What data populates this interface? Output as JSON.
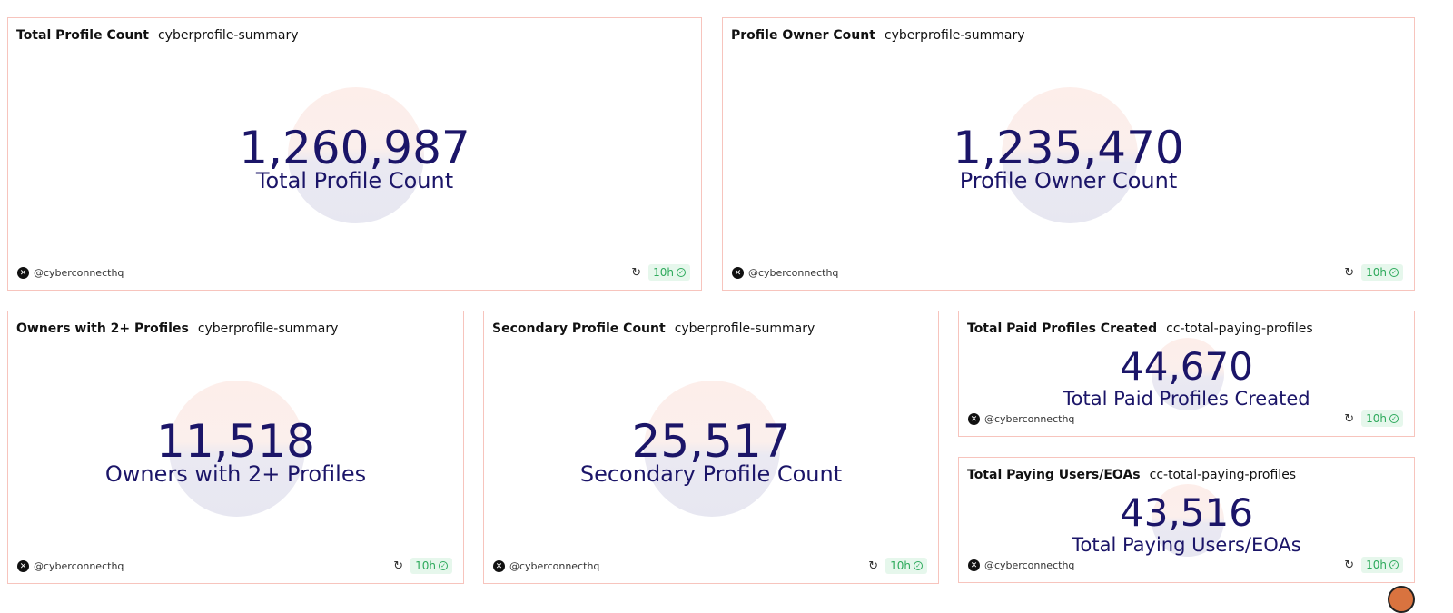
{
  "cards": [
    {
      "title": "Total Profile Count",
      "query": "cyberprofile-summary",
      "value": "1,260,987",
      "label": "Total Profile Count",
      "author": "@cyberconnecthq",
      "age": "10h"
    },
    {
      "title": "Profile Owner Count",
      "query": "cyberprofile-summary",
      "value": "1,235,470",
      "label": "Profile Owner Count",
      "author": "@cyberconnecthq",
      "age": "10h"
    },
    {
      "title": "Owners with 2+ Profiles",
      "query": "cyberprofile-summary",
      "value": "11,518",
      "label": "Owners with 2+ Profiles",
      "author": "@cyberconnecthq",
      "age": "10h"
    },
    {
      "title": "Secondary Profile Count",
      "query": "cyberprofile-summary",
      "value": "25,517",
      "label": "Secondary Profile Count",
      "author": "@cyberconnecthq",
      "age": "10h"
    },
    {
      "title": "Total Paid Profiles Created",
      "query": "cc-total-paying-profiles",
      "value": "44,670",
      "label": "Total Paid Profiles Created",
      "author": "@cyberconnecthq",
      "age": "10h"
    },
    {
      "title": "Total Paying Users/EOAs",
      "query": "cc-total-paying-profiles",
      "value": "43,516",
      "label": "Total Paying Users/EOAs",
      "author": "@cyberconnecthq",
      "age": "10h"
    }
  ]
}
